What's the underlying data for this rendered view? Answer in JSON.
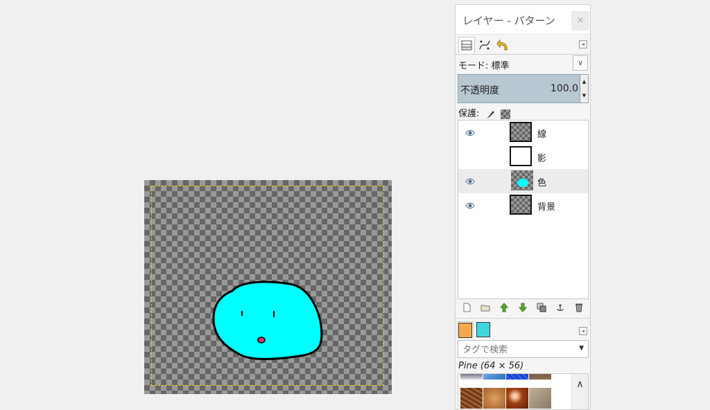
{
  "panel": {
    "title": "レイヤー - パターン",
    "close": "×",
    "mode_label": "モード: 標準",
    "opacity_label": "不透明度",
    "opacity_value": "100.0",
    "lock_label": "保護:",
    "layers": [
      {
        "name": "線",
        "visible": true,
        "active": false
      },
      {
        "name": "影",
        "visible": false,
        "active": false
      },
      {
        "name": "色",
        "visible": true,
        "active": true
      },
      {
        "name": "背景",
        "visible": true,
        "active": false
      }
    ],
    "tag_placeholder": "タグで検索",
    "pattern_name": "Pine (64 × 56)"
  },
  "colors": {
    "blob": "#00ffff",
    "mouth": "#e0306a",
    "selection": "#e6d200",
    "opacity_bar": "#b8c8d2"
  }
}
